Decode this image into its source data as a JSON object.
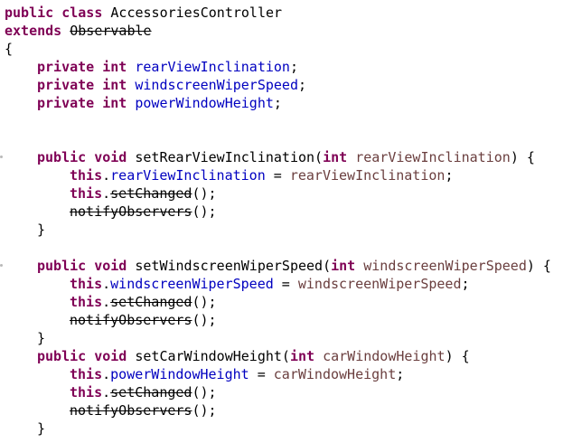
{
  "code": {
    "class_decl": {
      "kw_public": "public",
      "kw_class": "class",
      "class_name": "AccessoriesController"
    },
    "extends_decl": {
      "kw_extends": "extends",
      "superclass": "Observable"
    },
    "open_brace": "{",
    "fields": [
      {
        "kw_private": "private",
        "type": "int",
        "name": "rearViewInclination",
        "end": ";"
      },
      {
        "kw_private": "private",
        "type": "int",
        "name": "windscreenWiperSpeed",
        "end": ";"
      },
      {
        "kw_private": "private",
        "type": "int",
        "name": "powerWindowHeight",
        "end": ";"
      }
    ],
    "methods": [
      {
        "kw_public": "public",
        "kw_void": "void",
        "name": "setRearViewInclination(",
        "param_type": "int",
        "param_name": "rearViewInclination",
        "sig_end": ") {",
        "this_kw": "this",
        "dot": ".",
        "assign_field": "rearViewInclination",
        "assign_op": " = ",
        "assign_value": "rearViewInclination",
        "assign_end": ";",
        "set_changed": "setChanged",
        "call_end": "();",
        "notify": "notifyObservers",
        "close": "}"
      },
      {
        "kw_public": "public",
        "kw_void": "void",
        "name": "setWindscreenWiperSpeed(",
        "param_type": "int",
        "param_name": "windscreenWiperSpeed",
        "sig_end": ") {",
        "this_kw": "this",
        "dot": ".",
        "assign_field": "windscreenWiperSpeed",
        "assign_op": " = ",
        "assign_value": "windscreenWiperSpeed",
        "assign_end": ";",
        "set_changed": "setChanged",
        "call_end": "();",
        "notify": "notifyObservers",
        "close": "}"
      },
      {
        "kw_public": "public",
        "kw_void": "void",
        "name": "setCarWindowHeight(",
        "param_type": "int",
        "param_name": "carWindowHeight",
        "sig_end": ") {",
        "this_kw": "this",
        "dot": ".",
        "assign_field": "powerWindowHeight",
        "assign_op": " = ",
        "assign_value": "carWindowHeight",
        "assign_end": ";",
        "set_changed": "setChanged",
        "call_end": "();",
        "notify": "notifyObservers",
        "close": "}"
      }
    ]
  },
  "colors": {
    "keyword": "#7f0055",
    "field": "#0000c0",
    "variable": "#6a3e3e",
    "text": "#000000",
    "background": "#ffffff"
  }
}
